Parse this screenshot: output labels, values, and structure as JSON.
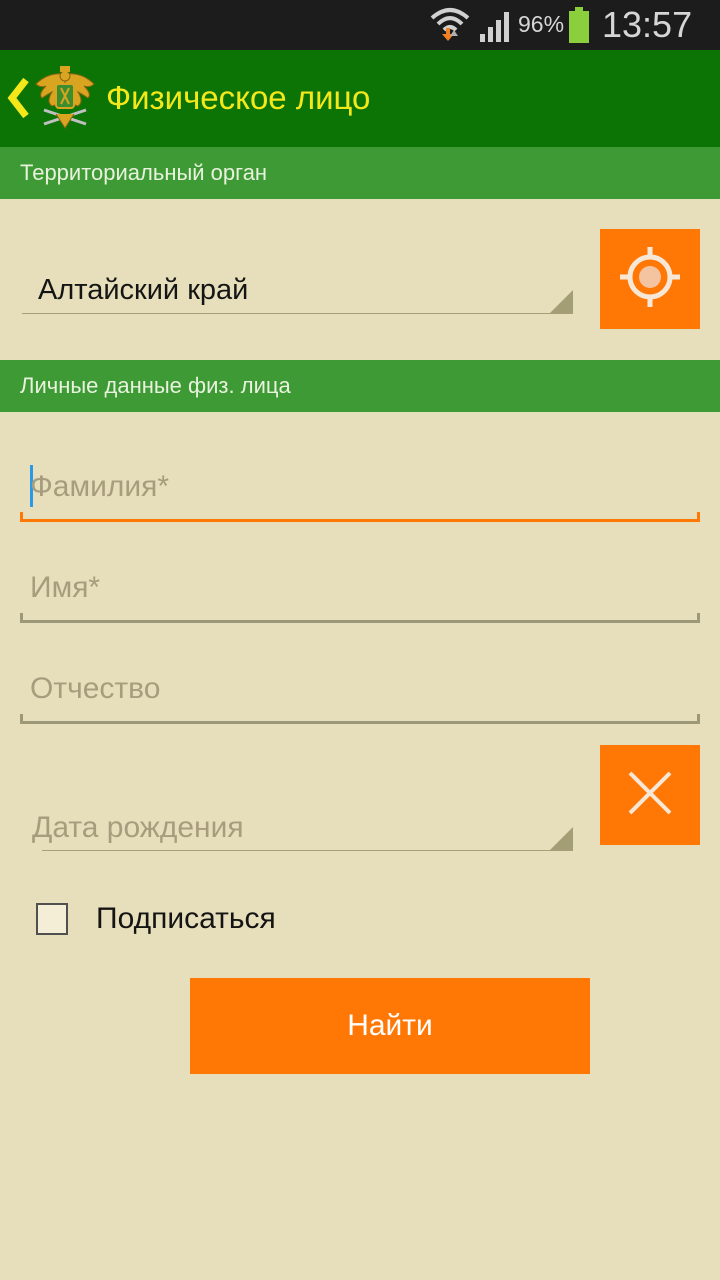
{
  "status_bar": {
    "battery_percent": "96%",
    "time": "13:57",
    "icons": [
      "wifi-icon",
      "signal-icon",
      "battery-icon"
    ]
  },
  "action_bar": {
    "title": "Физическое лицо",
    "icons": [
      "back-chevron-icon",
      "emblem-logo"
    ]
  },
  "section_territorial": {
    "title": "Территориальный орган",
    "region_selected": "Алтайский край",
    "locate_icon": "crosshair-icon"
  },
  "section_personal": {
    "title": "Личные данные физ. лица",
    "last_name_placeholder": "Фамилия*",
    "first_name_placeholder": "Имя*",
    "middle_name_placeholder": "Отчество",
    "birth_date_placeholder": "Дата рождения",
    "clear_icon": "close-icon",
    "subscribe_label": "Подписаться",
    "subscribe_checked": false
  },
  "submit_label": "Найти",
  "colors": {
    "background": "#e7dfbb",
    "action_bar": "#0b7405",
    "section_header": "#3d9a35",
    "accent_orange": "#ff7806",
    "title_yellow": "#f4e81b"
  }
}
